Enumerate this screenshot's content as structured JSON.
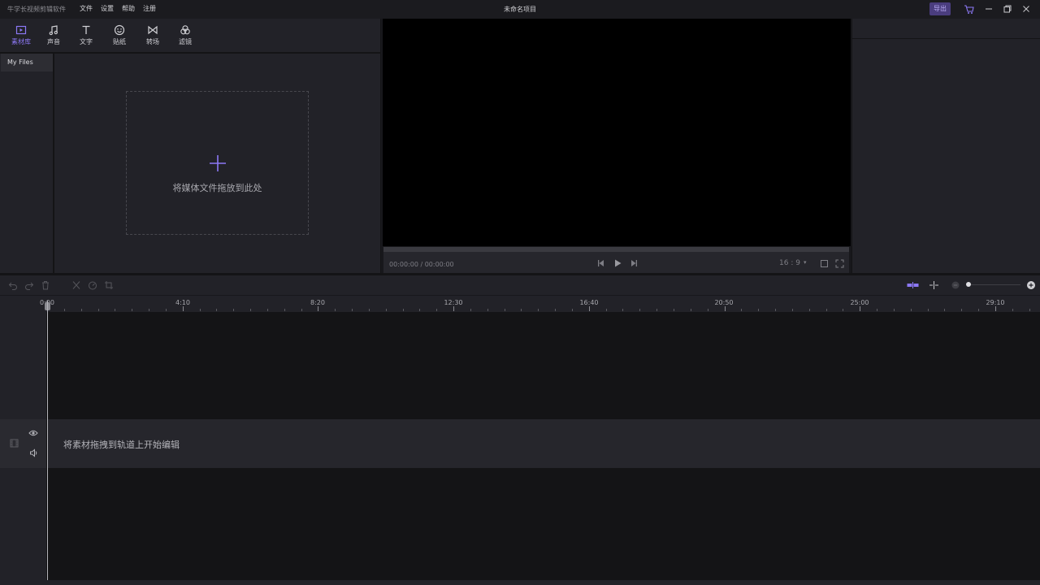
{
  "titlebar": {
    "app_name": "牛学长视频剪辑软件",
    "menu": [
      "文件",
      "设置",
      "帮助",
      "注册"
    ],
    "project_title": "未命名项目",
    "export_label": "导出"
  },
  "toolbar": {
    "tools": [
      {
        "label": "素材库",
        "icon": "media-library-icon",
        "active": true
      },
      {
        "label": "声音",
        "icon": "music-note-icon",
        "active": false
      },
      {
        "label": "文字",
        "icon": "text-icon",
        "active": false
      },
      {
        "label": "贴纸",
        "icon": "sticker-smiley-icon",
        "active": false
      },
      {
        "label": "转场",
        "icon": "transition-bowtie-icon",
        "active": false
      },
      {
        "label": "滤镜",
        "icon": "filter-circles-icon",
        "active": false
      }
    ]
  },
  "library": {
    "sidebar_item": "My Files",
    "drop_hint": "将媒体文件拖放到此处"
  },
  "preview": {
    "timecode": "00:00:00 / 00:00:00",
    "aspect_ratio": "16 : 9"
  },
  "timeline": {
    "ruler_labels": [
      "0:00",
      "4:10",
      "8:20",
      "12:30",
      "16:40",
      "20:50",
      "25:00",
      "29:10"
    ],
    "track_hint": "将素材拖拽到轨道上开始编辑"
  },
  "colors": {
    "accent": "#8c78f5",
    "export_bg": "#4a3d7e",
    "panel_bg": "#222228",
    "track_bg": "#141416"
  }
}
